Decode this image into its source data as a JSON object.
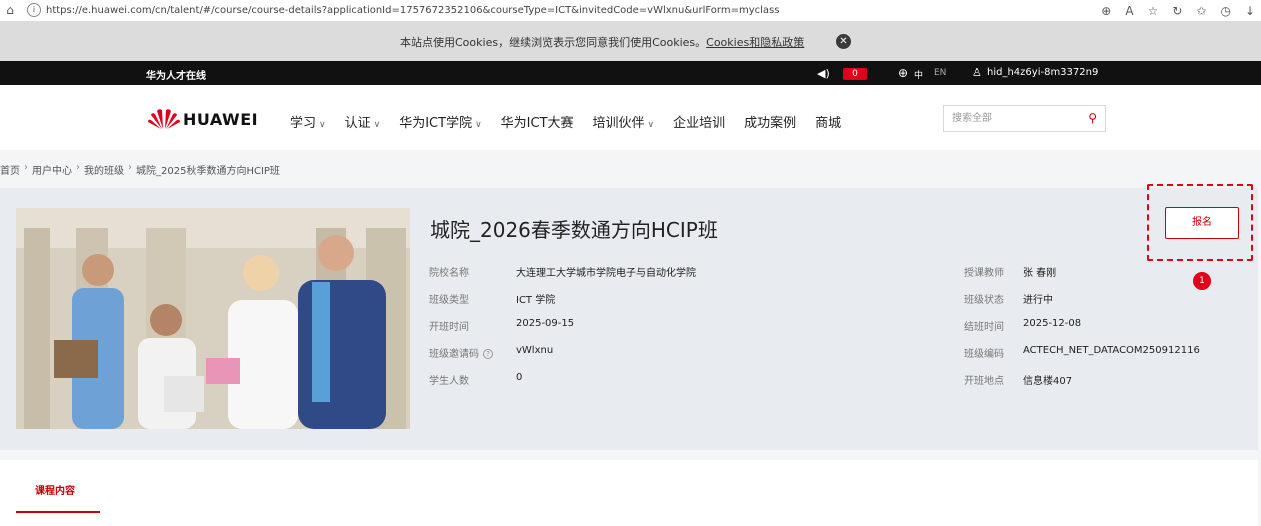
{
  "browser": {
    "url": "https://e.huawei.com/cn/talent/#/course/course-details?applicationId=1757672352106&courseType=ICT&invitedCode=vWlxnu&urlForm=myclass",
    "icons": [
      "home-icon",
      "lock-icon",
      "zoom-icon",
      "read-aloud-icon",
      "favorite-icon",
      "refresh-icon",
      "collections-icon",
      "history-icon",
      "download-icon"
    ]
  },
  "cookie_bar": {
    "text": "本站点使用Cookies，继续浏览表示您同意我们使用Cookies。",
    "link": "Cookies和隐私政策",
    "close": "✕"
  },
  "top_bar": {
    "brand": "华为人才在线",
    "msg_count": "0",
    "lang_zh": "中",
    "lang_en": "EN",
    "username": "hid_h4z6yi-8m3372n9"
  },
  "nav": {
    "logo_text": "HUAWEI",
    "items": [
      {
        "label": "学习",
        "dropdown": true
      },
      {
        "label": "认证",
        "dropdown": true
      },
      {
        "label": "华为ICT学院",
        "dropdown": true
      },
      {
        "label": "华为ICT大赛",
        "dropdown": false
      },
      {
        "label": "培训伙伴",
        "dropdown": true
      },
      {
        "label": "企业培训",
        "dropdown": false
      },
      {
        "label": "成功案例",
        "dropdown": false
      },
      {
        "label": "商城",
        "dropdown": false
      }
    ],
    "search_placeholder": "搜索全部"
  },
  "breadcrumb": [
    "首页",
    "用户中心",
    "我的班级",
    "城院_2025秋季数通方向HCIP班"
  ],
  "course": {
    "title": "城院_2026春季数通方向HCIP班",
    "left_fields": [
      {
        "label": "院校名称",
        "value": "大连理工大学城市学院电子与自动化学院"
      },
      {
        "label": "班级类型",
        "value": "ICT 学院"
      },
      {
        "label": "开班时间",
        "value": "2025-09-15"
      },
      {
        "label": "班级邀请码",
        "value": "vWlxnu",
        "help": true
      },
      {
        "label": "学生人数",
        "value": "0"
      }
    ],
    "right_fields": [
      {
        "label": "授课教师",
        "value": "张 春刚"
      },
      {
        "label": "班级状态",
        "value": "进行中"
      },
      {
        "label": "结班时间",
        "value": "2025-12-08"
      },
      {
        "label": "班级编码",
        "value": "ACTECH_NET_DATACOM250912116"
      },
      {
        "label": "开班地点",
        "value": "信息楼407"
      }
    ],
    "register_label": "报名",
    "step_badge": "1"
  },
  "tabs": [
    {
      "label": "课程内容",
      "active": true
    }
  ],
  "colors": {
    "brand_red": "#c7000b",
    "highlight_red": "#e1001a",
    "panel_bg": "#e8ebf0"
  }
}
